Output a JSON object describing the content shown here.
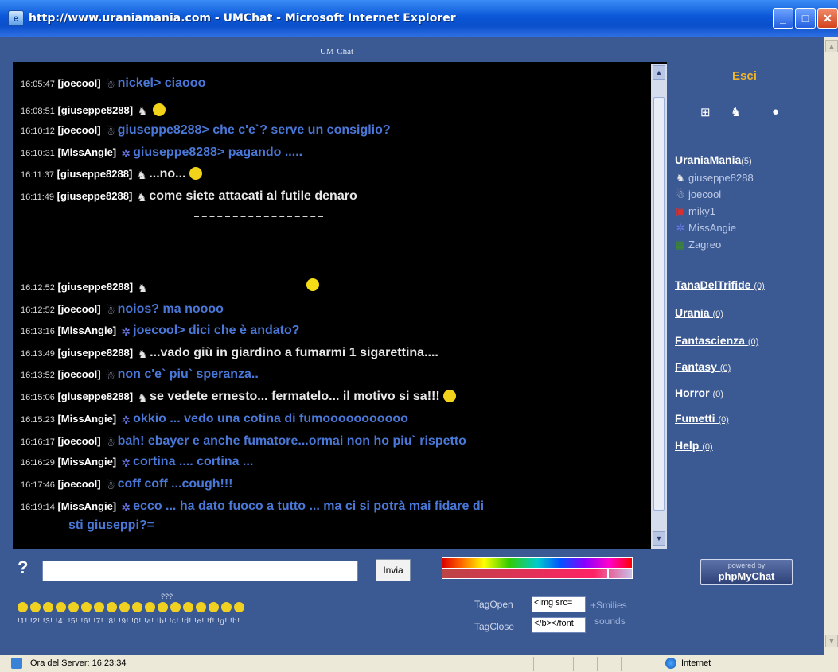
{
  "window": {
    "title": "http://www.uraniamania.com - UMChat - Microsoft Internet Explorer",
    "frame_title": "UM-Chat"
  },
  "messages": [
    {
      "time": "16:05:47",
      "nick": "[joecool]",
      "icon": "cool-icon",
      "text": "nickel> ciaooo",
      "color": "blue"
    },
    {
      "time": "16:08:51",
      "nick": "[giuseppe8288]",
      "icon": "horse-icon",
      "text": "",
      "color": "white",
      "smiley": true
    },
    {
      "time": "16:10:12",
      "nick": "[joecool]",
      "icon": "cool-icon",
      "text": "giuseppe8288> che c'e`? serve un consiglio?",
      "color": "blue"
    },
    {
      "time": "16:10:31",
      "nick": "[MissAngie]",
      "icon": "alien-icon",
      "text": "giuseppe8288> pagando .....",
      "color": "blue"
    },
    {
      "time": "16:11:37",
      "nick": "[giuseppe8288]",
      "icon": "horse-icon",
      "text": "...no...",
      "color": "white",
      "smiley": true
    },
    {
      "time": "16:11:49",
      "nick": "[giuseppe8288]",
      "icon": "horse-icon",
      "text": "come siete attacati al futile denaro",
      "color": "white"
    },
    {
      "time": "16:12:52",
      "nick": "[giuseppe8288]",
      "icon": "horse-icon",
      "text": "",
      "color": "white"
    },
    {
      "time": "16:12:52",
      "nick": "[joecool]",
      "icon": "cool-icon",
      "text": "noios? ma noooo",
      "color": "blue"
    },
    {
      "time": "16:13:16",
      "nick": "[MissAngie]",
      "icon": "alien-icon",
      "text": "joecool> dici che è andato?",
      "color": "blue"
    },
    {
      "time": "16:13:49",
      "nick": "[giuseppe8288]",
      "icon": "horse-icon",
      "text": "...vado giù in giardino a fumarmi 1 sigarettina....",
      "color": "white"
    },
    {
      "time": "16:13:52",
      "nick": "[joecool]",
      "icon": "cool-icon",
      "text": "non c'e` piu` speranza..",
      "color": "blue"
    },
    {
      "time": "16:15:06",
      "nick": "[giuseppe8288]",
      "icon": "horse-icon",
      "text": "se vedete ernesto... fermatelo... il motivo si sa!!!",
      "color": "white",
      "smiley": true
    },
    {
      "time": "16:15:23",
      "nick": "[MissAngie]",
      "icon": "alien-icon",
      "text": "okkio ... vedo una cotina di fumooooooooooo",
      "color": "blue"
    },
    {
      "time": "16:16:17",
      "nick": "[joecool]",
      "icon": "cool-icon",
      "text": "bah! ebayer e anche fumatore...ormai non ho piu` rispetto",
      "color": "blue"
    },
    {
      "time": "16:16:29",
      "nick": "[MissAngie]",
      "icon": "alien-icon",
      "text": "cortina .... cortina ...",
      "color": "blue"
    },
    {
      "time": "16:17:46",
      "nick": "[joecool]",
      "icon": "cool-icon",
      "text": "coff coff ...cough!!!",
      "color": "blue"
    },
    {
      "time": "16:19:14",
      "nick": "[MissAngie]",
      "icon": "alien-icon",
      "text": "ecco ... ha dato fuoco a tutto ... ma ci si potrà mai fidare di",
      "color": "blue",
      "continuation": "sti giuseppi?="
    }
  ],
  "panel": {
    "exit_label": "Esci",
    "current_room": "UraniaMania",
    "current_room_count": "(5)",
    "users": [
      {
        "name": "giuseppe8288",
        "icon": "horse-icon"
      },
      {
        "name": "joecool",
        "icon": "cool-icon"
      },
      {
        "name": "miky1",
        "icon": "red-icon"
      },
      {
        "name": "MissAngie",
        "icon": "alien-icon"
      },
      {
        "name": "Zagreo",
        "icon": "green-icon"
      }
    ],
    "rooms": [
      {
        "name": "TanaDelTrifide",
        "count": "(0)"
      },
      {
        "name": "Urania",
        "count": "(0)"
      },
      {
        "name": "Fantascienza",
        "count": "(0)"
      },
      {
        "name": "Fantasy",
        "count": "(0)"
      },
      {
        "name": "Horror",
        "count": "(0)"
      },
      {
        "name": "Fumetti",
        "count": "(0)"
      },
      {
        "name": "Help",
        "count": "(0)"
      }
    ]
  },
  "input": {
    "help_label": "?",
    "message_value": "",
    "send_label": "Invia"
  },
  "smilies": {
    "codes": "!1! !2! !3! !4! !5! !6! !7! !8! !9! !0! !a! !b! !c! !d! !e! !f! !g! !h!",
    "marker": "???"
  },
  "tags": {
    "open_label": "TagOpen",
    "open_value": "<img src=",
    "close_label": "TagClose",
    "close_value": "</b></font",
    "smilies_link": "+Smilies",
    "sounds_link": "sounds"
  },
  "powered": {
    "small": "powered by",
    "name": "phpMyChat"
  },
  "statusbar": {
    "text": "Ora del Server: 16:23:34",
    "zone": "Internet"
  },
  "colors": {
    "titlebar": "#0b57d8",
    "panel_bg": "#3b5a93",
    "chat_bg": "#000000",
    "blue_text": "#4a78d8",
    "exit": "#f0b428"
  }
}
